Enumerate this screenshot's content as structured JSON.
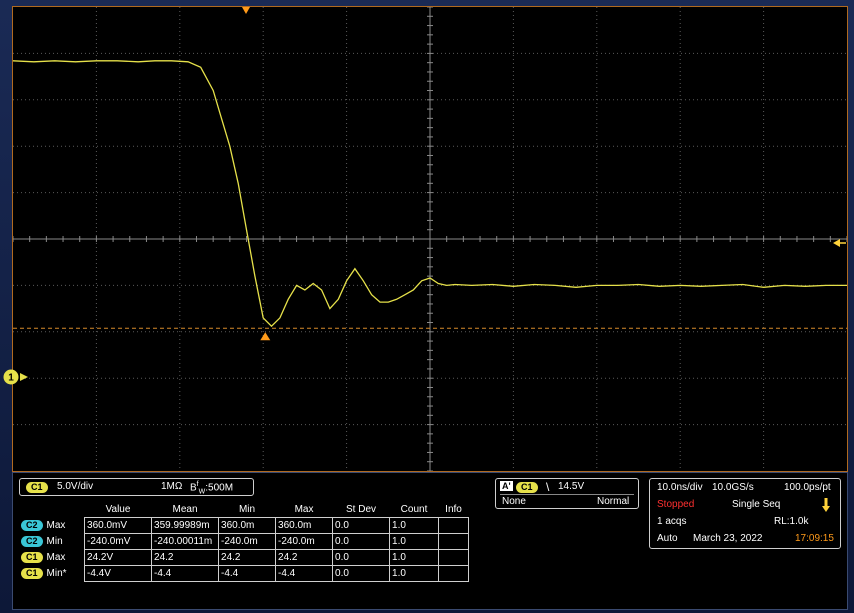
{
  "colors": {
    "trace": "#e6e14a",
    "trigger_marker": "#ff9a1a",
    "reference_line": "#d58a2a",
    "grid": "#5a5a5a",
    "c2_tag": "#3ac6d6",
    "stopped": "#ff3030"
  },
  "chart_data": {
    "type": "line",
    "title": "",
    "xlabel": "",
    "ylabel": "",
    "x_divisions": 10,
    "y_divisions": 10,
    "grid": true,
    "trigger_position_division": 0,
    "channel_marker_label": "1",
    "series": [
      {
        "x": [
          -10,
          -9.5,
          -9,
          -8.5,
          -8,
          -7.5,
          -7,
          -6.6,
          -6.2,
          -5.8,
          -5.5,
          -5.2,
          -5.0,
          -4.8,
          -4.6,
          -4.4,
          -4.2,
          -4.0,
          -3.8,
          -3.6,
          -3.4,
          -3.2,
          -3.0,
          -2.8,
          -2.6,
          -2.4,
          -2.2,
          -2.0,
          -1.8,
          -1.6,
          -1.4,
          -1.2,
          -1.0,
          -0.8,
          -0.6,
          -0.4,
          -0.2,
          0.0,
          0.2,
          0.4,
          0.6,
          1.0,
          1.5,
          2.0,
          2.5,
          3.0,
          3.5,
          4.0,
          4.5,
          5.0,
          5.5,
          6.0,
          6.5,
          7.0,
          7.5,
          8.0,
          8.5,
          9.0,
          9.5,
          10
        ],
        "y": [
          24.2,
          24.1,
          24.2,
          24.1,
          24.2,
          24.2,
          24.1,
          24.2,
          24.2,
          24.1,
          23.5,
          21.0,
          18.0,
          15.0,
          11.0,
          6.0,
          1.0,
          -3.5,
          -4.4,
          -3.5,
          -1.5,
          0.0,
          -0.5,
          0.2,
          -0.5,
          -2.5,
          -1.5,
          0.5,
          1.8,
          0.5,
          -1.0,
          -1.8,
          -1.8,
          -1.5,
          -1.0,
          -0.5,
          0.5,
          0.8,
          0.2,
          0.0,
          0.1,
          0.0,
          0.1,
          -0.1,
          0.1,
          0.0,
          -0.2,
          0.0,
          0.0,
          0.1,
          -0.1,
          0.0,
          -0.1,
          0.0,
          0.1,
          -0.2,
          0.0,
          -0.1,
          0.0,
          0.0
        ]
      }
    ],
    "ylim": [
      -20,
      30
    ],
    "xlim": [
      -10,
      10
    ]
  },
  "ch1": {
    "tag": "C1",
    "scale": "5.0V/div",
    "impedance": "1MΩ",
    "bw_b": "B",
    "bw_sup": "f",
    "bw_sub": "W",
    "bw_value": ":500M"
  },
  "meas": {
    "headers": [
      "Value",
      "Mean",
      "Min",
      "Max",
      "St Dev",
      "Count",
      "Info"
    ],
    "rows": [
      {
        "ch": "C2",
        "ch_class": "c2",
        "label": "Max",
        "value": "360.0mV",
        "mean": "359.99989m",
        "min": "360.0m",
        "max": "360.0m",
        "stdev": "0.0",
        "count": "1.0",
        "info": ""
      },
      {
        "ch": "C2",
        "ch_class": "c2",
        "label": "Min",
        "value": "-240.0mV",
        "mean": "-240.00011m",
        "min": "-240.0m",
        "max": "-240.0m",
        "stdev": "0.0",
        "count": "1.0",
        "info": ""
      },
      {
        "ch": "C1",
        "ch_class": "c1",
        "label": "Max",
        "value": "24.2V",
        "mean": "24.2",
        "min": "24.2",
        "max": "24.2",
        "stdev": "0.0",
        "count": "1.0",
        "info": ""
      },
      {
        "ch": "C1",
        "ch_class": "c1",
        "label": "Min*",
        "value": "-4.4V",
        "mean": "-4.4",
        "min": "-4.4",
        "max": "-4.4",
        "stdev": "0.0",
        "count": "1.0",
        "info": ""
      }
    ]
  },
  "trigger": {
    "a_tag": "A'",
    "source": "C1",
    "slope_symbol": "\\",
    "level": "14.5V",
    "coupling": "None",
    "mode": "Normal"
  },
  "acq": {
    "timebase": "10.0ns/div",
    "sample_rate": "10.0GS/s",
    "resolution": "100.0ps/pt",
    "status": "Stopped",
    "seq_mode": "Single Seq",
    "acqs": "1 acqs",
    "record_length": "RL:1.0k",
    "auto": "Auto",
    "date": "March 23, 2022",
    "time": "17:09:15"
  }
}
